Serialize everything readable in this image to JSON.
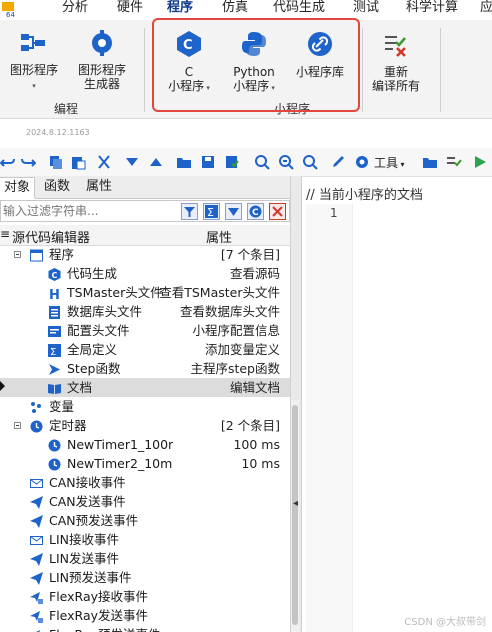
{
  "menu": {
    "items": [
      "分析",
      "硬件",
      "程序",
      "仿真",
      "代码生成",
      "测试",
      "科学计算",
      "应"
    ],
    "active_index": 2
  },
  "ribbon": {
    "buttons": {
      "graphic_program": "图形程序",
      "graphic_generator_l1": "图形程序",
      "graphic_generator_l2": "生成器",
      "c_l1": "C",
      "c_l2": "小程序",
      "python_l1": "Python",
      "python_l2": "小程序",
      "lib": "小程序库",
      "recompile_l1": "重新",
      "recompile_l2": "编译所有"
    },
    "groups": {
      "edit": "编程",
      "applet": "小程序"
    },
    "accent": "#e2463f",
    "icon_blue": "#1e63c9"
  },
  "version": "2024.8.12.1163",
  "toolbar": {
    "tools_label": "工具"
  },
  "panel": {
    "tabs": [
      "对象",
      "函数",
      "属性"
    ],
    "selected_tab": 0,
    "filter_placeholder": "输入过滤字符串...",
    "header": {
      "col1": "源代码编辑器",
      "col2": "属性"
    }
  },
  "tree": [
    {
      "name": "程序",
      "value": "[7 个条目]",
      "level": 1,
      "icon": "window-icon",
      "expand": true
    },
    {
      "name": "代码生成",
      "value": "查看源码",
      "level": 2,
      "icon": "c-icon"
    },
    {
      "name": "TSMaster头文件",
      "value": "查看TSMaster头文件",
      "level": 2,
      "icon": "h-icon"
    },
    {
      "name": "数据库头文件",
      "value": "查看数据库头文件",
      "level": 2,
      "icon": "database-icon"
    },
    {
      "name": "配置头文件",
      "value": "小程序配置信息",
      "level": 2,
      "icon": "config-icon"
    },
    {
      "name": "全局定义",
      "value": "添加变量定义",
      "level": 2,
      "icon": "sigma-icon"
    },
    {
      "name": "Step函数",
      "value": "主程序step函数",
      "level": 2,
      "icon": "arrow-icon"
    },
    {
      "name": "文档",
      "value": "编辑文档",
      "level": 2,
      "icon": "book-icon",
      "selected": true
    },
    {
      "name": "变量",
      "value": "",
      "level": 1,
      "icon": "variables-icon"
    },
    {
      "name": "定时器",
      "value": "[2 个条目]",
      "level": 1,
      "icon": "clock-icon",
      "expand": true
    },
    {
      "name": "NewTimer1_100r",
      "value": "100 ms",
      "level": 2,
      "icon": "clock-icon"
    },
    {
      "name": "NewTimer2_10m",
      "value": "10 ms",
      "level": 2,
      "icon": "clock-icon"
    },
    {
      "name": "CAN接收事件",
      "value": "",
      "level": 1,
      "icon": "mail-icon"
    },
    {
      "name": "CAN发送事件",
      "value": "",
      "level": 1,
      "icon": "send-icon"
    },
    {
      "name": "CAN预发送事件",
      "value": "",
      "level": 1,
      "icon": "send-icon"
    },
    {
      "name": "LIN接收事件",
      "value": "",
      "level": 1,
      "icon": "mail-icon"
    },
    {
      "name": "LIN发送事件",
      "value": "",
      "level": 1,
      "icon": "send-icon"
    },
    {
      "name": "LIN预发送事件",
      "value": "",
      "level": 1,
      "icon": "send-icon"
    },
    {
      "name": "FlexRay接收事件",
      "value": "",
      "level": 1,
      "icon": "flexray-icon"
    },
    {
      "name": "FlexRay发送事件",
      "value": "",
      "level": 1,
      "icon": "flexray-icon"
    },
    {
      "name": "FlexRay预发送事件",
      "value": "",
      "level": 1,
      "icon": "flexray-icon"
    }
  ],
  "editor": {
    "comment": "// 当前小程序的文档",
    "line_number": "1"
  },
  "watermark": "CSDN @大叔带剑"
}
